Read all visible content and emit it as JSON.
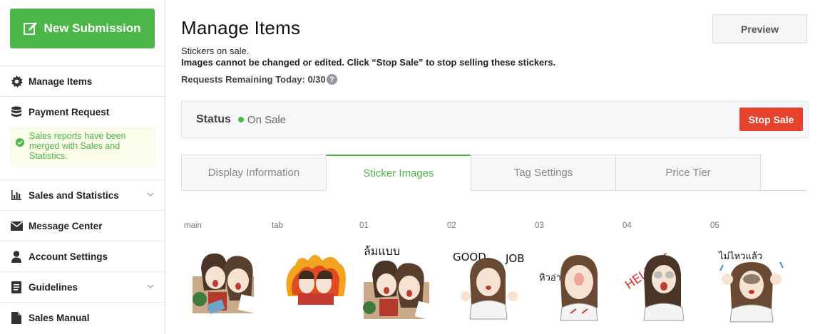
{
  "sidebar": {
    "new_submission": "New Submission",
    "items": [
      {
        "label": "Manage Items",
        "icon": "gear-icon"
      },
      {
        "label": "Payment Request",
        "icon": "coins-icon"
      },
      {
        "label": "Sales and Statistics",
        "icon": "bar-chart-icon",
        "expandable": true
      },
      {
        "label": "Message Center",
        "icon": "envelope-icon"
      },
      {
        "label": "Account Settings",
        "icon": "user-icon"
      },
      {
        "label": "Guidelines",
        "icon": "book-icon",
        "expandable": true
      },
      {
        "label": "Sales Manual",
        "icon": "document-icon"
      }
    ],
    "notice": "Sales reports have been merged with Sales and Statistics."
  },
  "header": {
    "title": "Manage Items",
    "preview": "Preview",
    "line1": "Stickers on sale.",
    "line2": "Images cannot be changed or edited. Click “Stop Sale” to stop selling these stickers.",
    "requests": "Requests Remaining Today: 0/30"
  },
  "status": {
    "label": "Status",
    "value": "On Sale",
    "stop_sale": "Stop Sale",
    "color": "#4cb648"
  },
  "tabs": [
    {
      "label": "Display Information",
      "active": false
    },
    {
      "label": "Sticker Images",
      "active": true
    },
    {
      "label": "Tag Settings",
      "active": false
    },
    {
      "label": "Price Tier",
      "active": false
    }
  ],
  "stickers": {
    "slots": [
      "main",
      "tab",
      "01",
      "02",
      "03",
      "04",
      "05"
    ],
    "texts": {
      "s01": "ล้มแบบ",
      "s02a": "GOOD",
      "s02b": "JOB",
      "s03": "หิวอ่า",
      "s04": "HELP ME",
      "s05": "ไม่ไหวแล้ว"
    }
  },
  "colors": {
    "accent": "#4cb648",
    "danger": "#e5432b"
  }
}
